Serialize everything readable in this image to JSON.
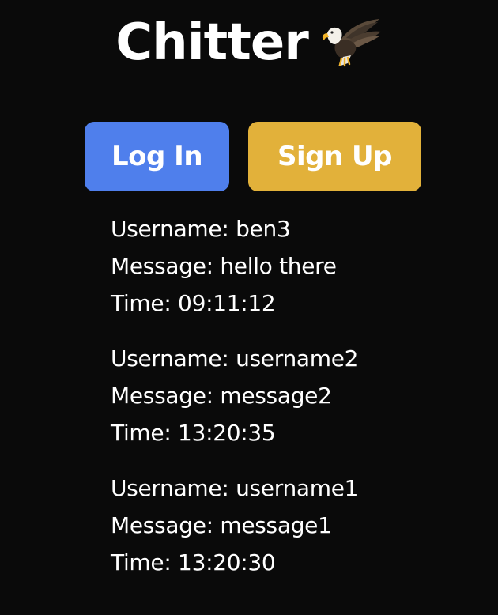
{
  "app": {
    "title": "Chitter",
    "logo_icon": "eagle-icon"
  },
  "auth": {
    "login_label": "Log In",
    "signup_label": "Sign Up"
  },
  "colors": {
    "background": "#0a0a0a",
    "login_button": "#4f7fec",
    "signup_button": "#e2b13a",
    "text": "#ffffff"
  },
  "messages": [
    {
      "username_line": "Username: ben3",
      "message_line": "Message: hello there",
      "time_line": "Time: 09:11:12"
    },
    {
      "username_line": "Username: username2",
      "message_line": "Message: message2",
      "time_line": "Time: 13:20:35"
    },
    {
      "username_line": "Username: username1",
      "message_line": "Message: message1",
      "time_line": "Time: 13:20:30"
    }
  ]
}
